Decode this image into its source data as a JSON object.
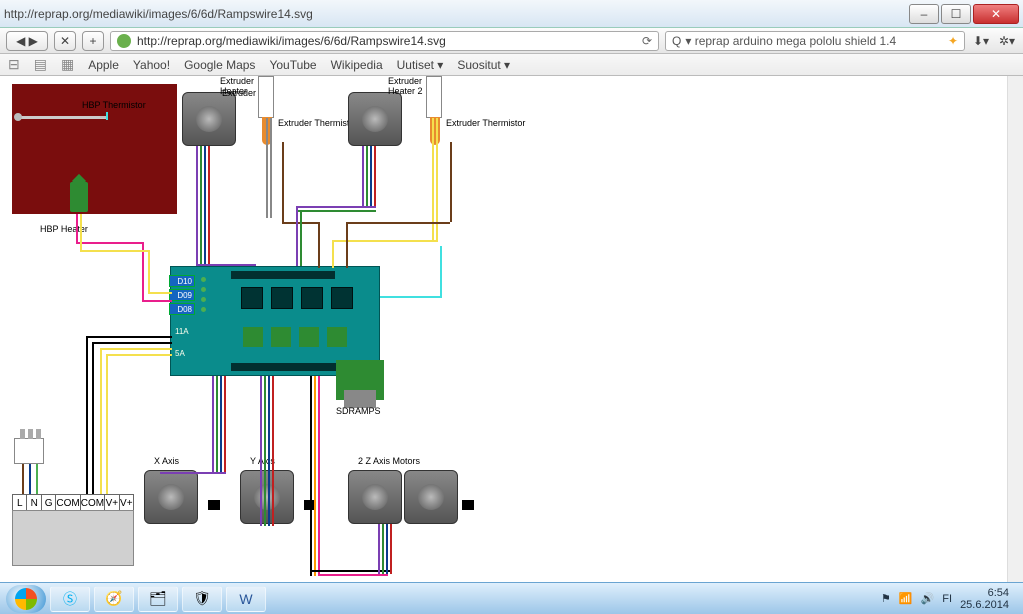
{
  "window": {
    "title": "http://reprap.org/mediawiki/images/6/6d/Rampswire14.svg"
  },
  "url": "http://reprap.org/mediawiki/images/6/6d/Rampswire14.svg",
  "search": {
    "query": "reprap arduino mega pololu shield 1.4",
    "engine_icon": "Q"
  },
  "bookmarks": [
    "Apple",
    "Yahoo!",
    "Google Maps",
    "YouTube",
    "Wikipedia",
    "Uutiset ▾",
    "Suositut ▾"
  ],
  "diagram": {
    "hbp_thermistor": "HBP Thermistor",
    "hbp_heater": "HBP Heater",
    "extruder1_motor": "Extruder",
    "extruder1_heater": "Extruder\nHeater",
    "extruder1_therm": "Extruder\nThermistor",
    "extruder2_motor": "Extruder 2",
    "extruder2_heater": "Extruder\nHeater 2",
    "extruder2_therm": "Extruder\nThermistor",
    "sdramps": "SDRAMPS",
    "x_axis": "X Axis",
    "y_axis": "Y Axis",
    "z_axis": "2 Z Axis Motors",
    "board": {
      "d10": "D10",
      "d09": "D09",
      "d08": "D08",
      "a11": "11A",
      "a5": "5A"
    },
    "psu_terms": [
      "L",
      "N",
      "G",
      "COM",
      "COM",
      "V+",
      "V+"
    ]
  },
  "tray": {
    "lang": "FI",
    "time": "6:54",
    "date": "25.6.2014"
  }
}
